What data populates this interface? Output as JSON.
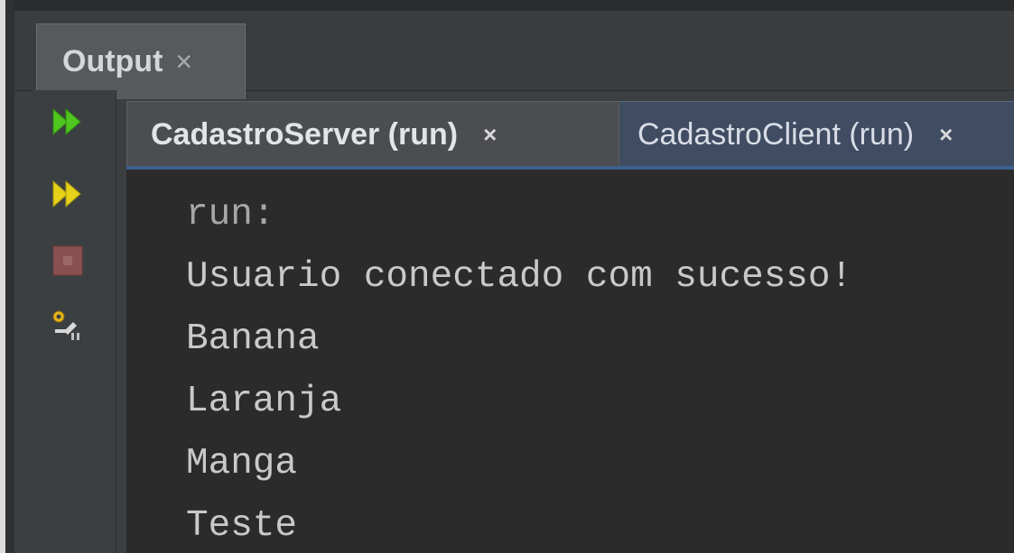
{
  "window": {
    "tab_title": "Output",
    "tab_close_glyph": "×"
  },
  "toolbar": {
    "rerun_icon": "rerun-icon",
    "rerun_options_icon": "rerun-with-options-icon",
    "stop_icon": "stop-icon",
    "settings_icon": "settings-icon"
  },
  "run_tabs": [
    {
      "label": "CadastroServer (run)",
      "close": "×",
      "selected": true
    },
    {
      "label": "CadastroClient (run)",
      "close": "×",
      "selected": false
    }
  ],
  "console": {
    "lines": [
      "run:",
      "Usuario conectado com sucesso!",
      "Banana",
      "Laranja",
      "Manga",
      "Teste"
    ]
  },
  "colors": {
    "run_green": "#4ec61f",
    "run_yellow": "#e6d11a",
    "stop_red": "#8a5050",
    "active_tab": "#4b4d50",
    "inactive_tab": "#3f4c62",
    "console_bg": "#2b2b2b"
  }
}
